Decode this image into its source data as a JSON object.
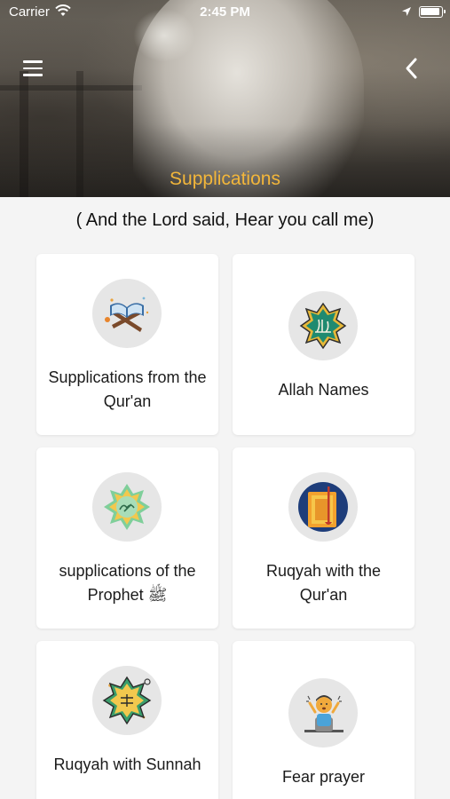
{
  "status_bar": {
    "carrier": "Carrier",
    "time": "2:45 PM"
  },
  "header": {
    "title": "Supplications",
    "title_color": "#f3b63a"
  },
  "verse": "( And the Lord said, Hear you call me)",
  "cards": [
    {
      "label": "Supplications from the Qur'an",
      "icon": "quran-book-icon"
    },
    {
      "label": "Allah Names",
      "icon": "allah-calligraphy-star-icon"
    },
    {
      "label": "supplications of the Prophet ﷺ",
      "icon": "muhammad-calligraphy-star-icon"
    },
    {
      "label": "Ruqyah with the Qur'an",
      "icon": "quran-bookmark-icon"
    },
    {
      "label": "Ruqyah with Sunnah",
      "icon": "islamic-star-frame-icon"
    },
    {
      "label": "Fear prayer",
      "icon": "frightened-person-icon"
    }
  ]
}
